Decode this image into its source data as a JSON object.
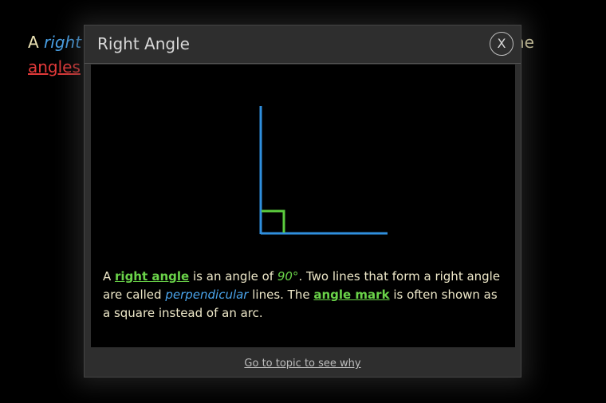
{
  "background": {
    "line1_prefix": "A ",
    "line1_term": "right a",
    "line1_suffix": "he",
    "line2_link": "angles"
  },
  "modal": {
    "title": "Right Angle",
    "close_label": "X",
    "description": {
      "p1": "A ",
      "term1": "right angle",
      "p2": " is an angle of ",
      "measure": "90°",
      "p3": ". Two lines that form a right angle are called ",
      "term2": "perpendicular",
      "p4": " lines. The ",
      "term3": "angle mark",
      "p5": " is often shown as a square instead of an arc."
    },
    "footer_link": "Go to topic to see why"
  },
  "colors": {
    "line_blue": "#2f8fde",
    "mark_green": "#5ccc3e",
    "term_green": "#6ad349",
    "term_blue": "#4aa3ea",
    "link_red": "#e43a3a"
  }
}
